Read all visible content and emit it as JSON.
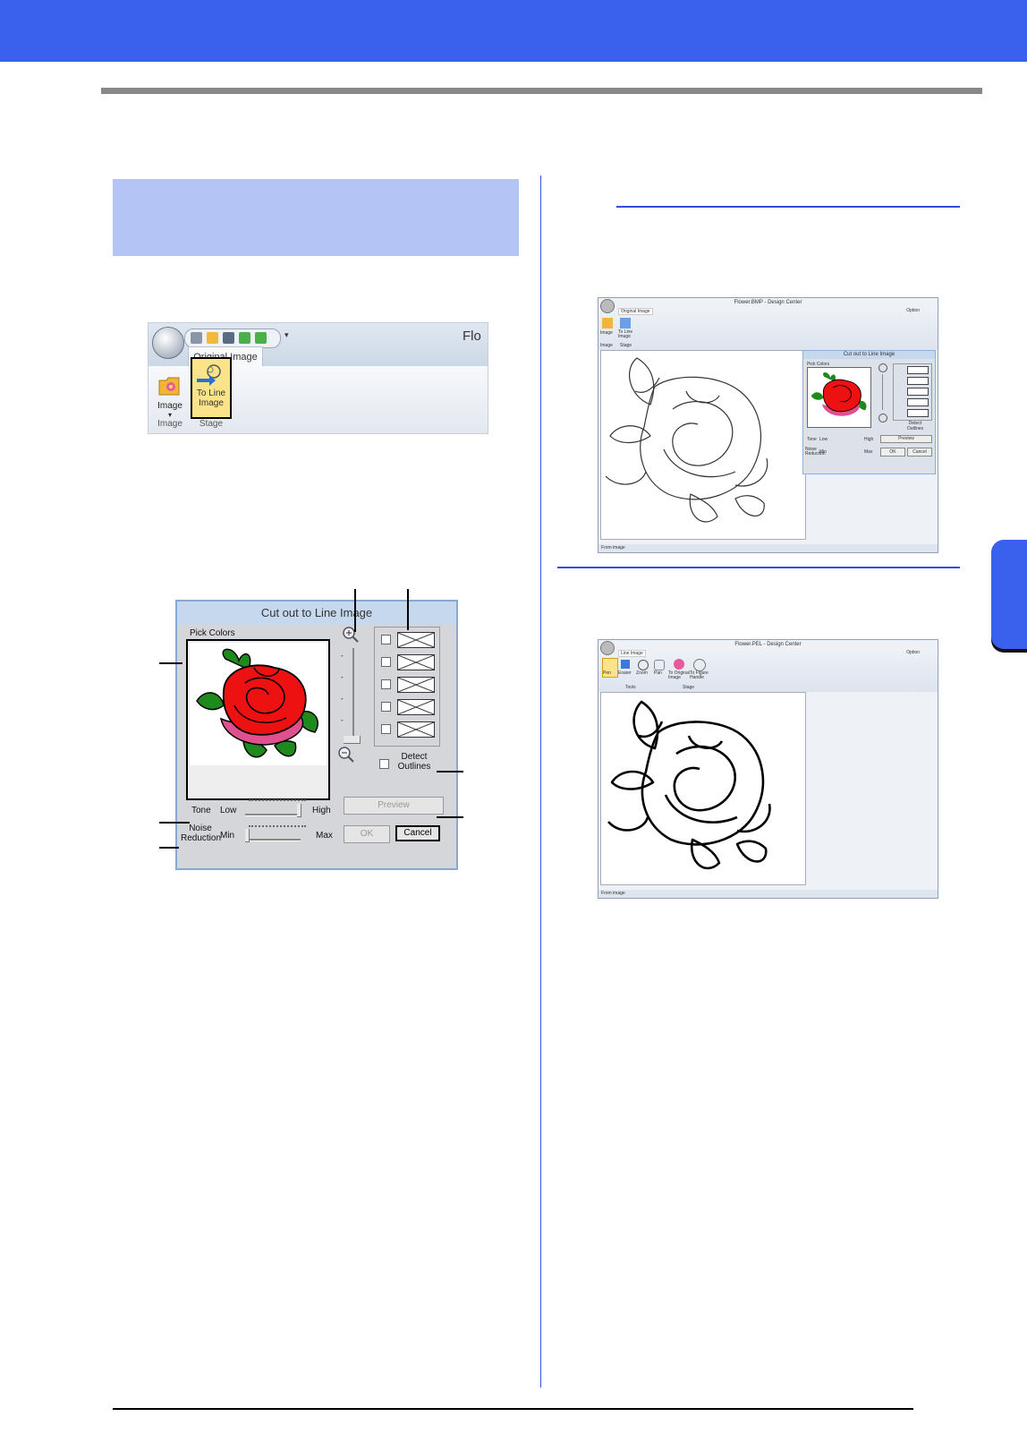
{
  "ribbon": {
    "app_title_fragment": "Flo",
    "tab": "Original Image",
    "image_btn": "Image",
    "to_line_btn": "To Line Image",
    "group_image": "Image",
    "group_stage": "Stage"
  },
  "dialog": {
    "title": "Cut out to Line Image",
    "pick_colors": "Pick Colors",
    "detect_outlines": "Detect Outlines",
    "tone": "Tone",
    "low": "Low",
    "high": "High",
    "noise_reduction": "Noise Reduction",
    "min": "Min",
    "max": "Max",
    "preview": "Preview",
    "ok": "OK",
    "cancel": "Cancel"
  },
  "window1": {
    "title": "Flower.BMP - Design Center",
    "tab": "Original Image",
    "btn_image": "Image",
    "btn_to_line": "To Line Image",
    "grp_image": "Image",
    "grp_stage": "Stage",
    "option": "Option",
    "status": "From image",
    "inner": {
      "title": "Cut out to Line Image",
      "pick_colors": "Pick Colors",
      "detect_outlines": "Detect Outlines",
      "preview": "Preview",
      "tone": "Tone",
      "low": "Low",
      "high": "High",
      "noise": "Noise Reduction",
      "min": "Min",
      "max": "Max",
      "ok": "OK",
      "cancel": "Cancel"
    }
  },
  "window2": {
    "title": "Flower.PEL - Design Center",
    "tab": "Line Image",
    "tools": [
      "Pen",
      "Eraser",
      "Zoom",
      "Pan"
    ],
    "grp_tools": "Tools",
    "stage_btns": [
      "To Original Image",
      "To Figure Handle"
    ],
    "grp_stage": "Stage",
    "option": "Option",
    "status": "From image"
  },
  "colors": {
    "header": "#3a61ee",
    "section_box": "#b3c4f5",
    "divider": "#2d4fe0"
  }
}
